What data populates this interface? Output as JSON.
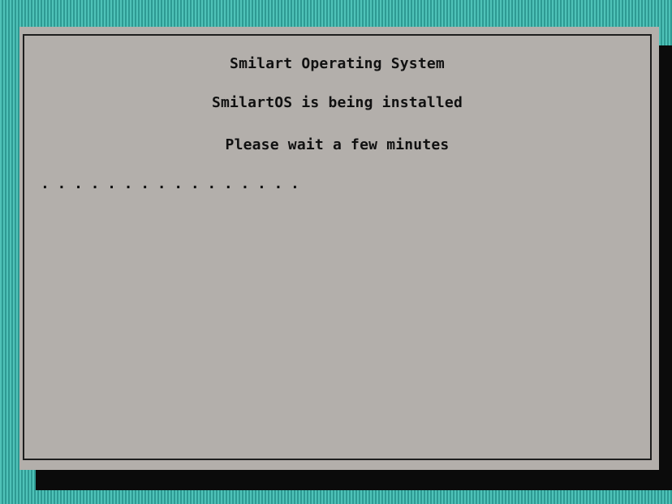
{
  "installer": {
    "title": "Smilart Operating System",
    "status": "SmilartOS is being installed",
    "hint": "Please wait a few minutes",
    "progress_dots": "................"
  },
  "colors": {
    "background": "#3fb3aa",
    "dialog": "#b3afab",
    "shadow": "#0b0b0b",
    "text": "#111111"
  }
}
